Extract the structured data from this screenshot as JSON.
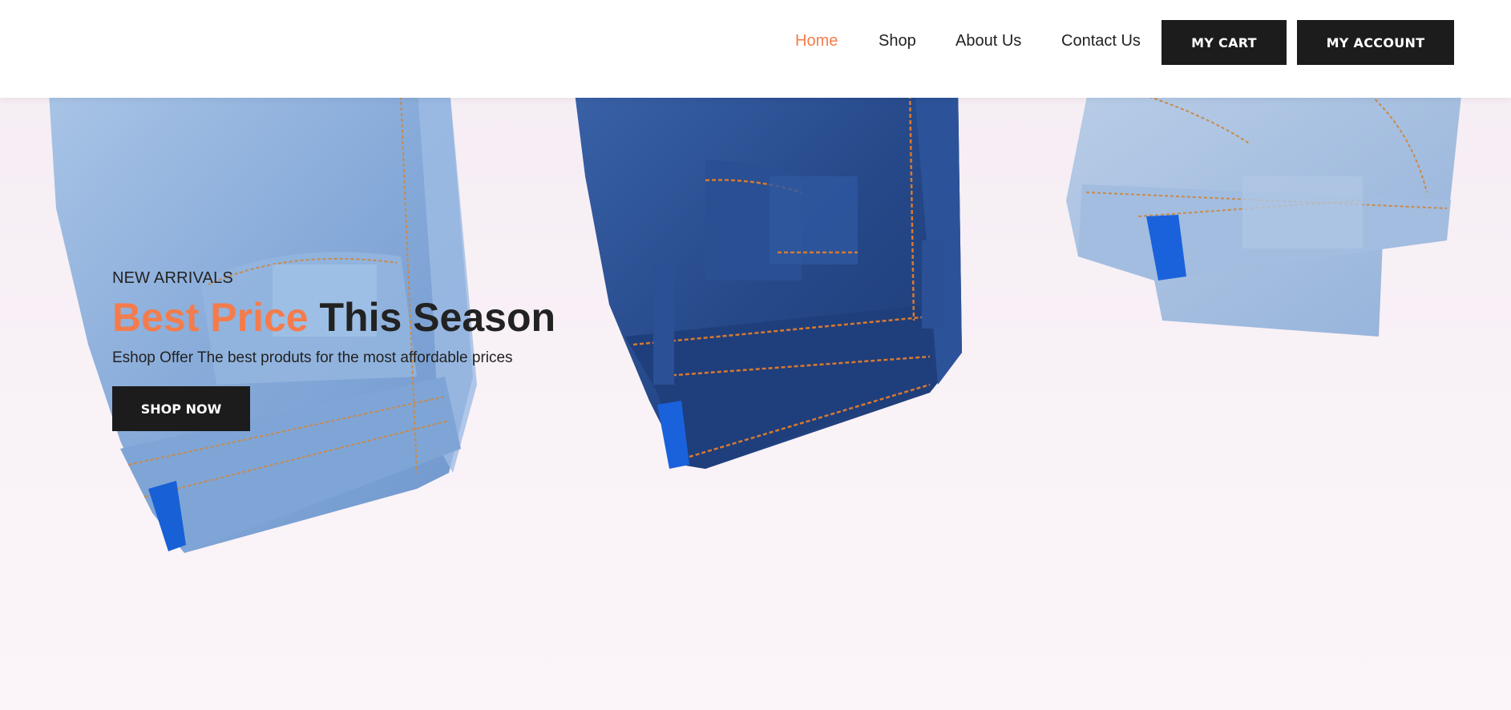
{
  "nav": {
    "links": [
      {
        "label": "Home",
        "active": true
      },
      {
        "label": "Shop",
        "active": false
      },
      {
        "label": "About Us",
        "active": false
      },
      {
        "label": "Contact Us",
        "active": false
      }
    ],
    "cart_label": "MY CART",
    "account_label": "MY ACCOUNT"
  },
  "hero": {
    "eyebrow": "NEW ARRIVALS",
    "headline_accent": "Best Price",
    "headline_rest": "This Season",
    "subline": "Eshop Offer The best produts for the most affordable prices",
    "cta_label": "SHOP NOW"
  },
  "colors": {
    "accent": "#f47c4c",
    "dark": "#1c1c1c",
    "background": "#f8f1f6",
    "denim_light": "#8fb3dd",
    "denim_dark": "#2a4f92"
  }
}
